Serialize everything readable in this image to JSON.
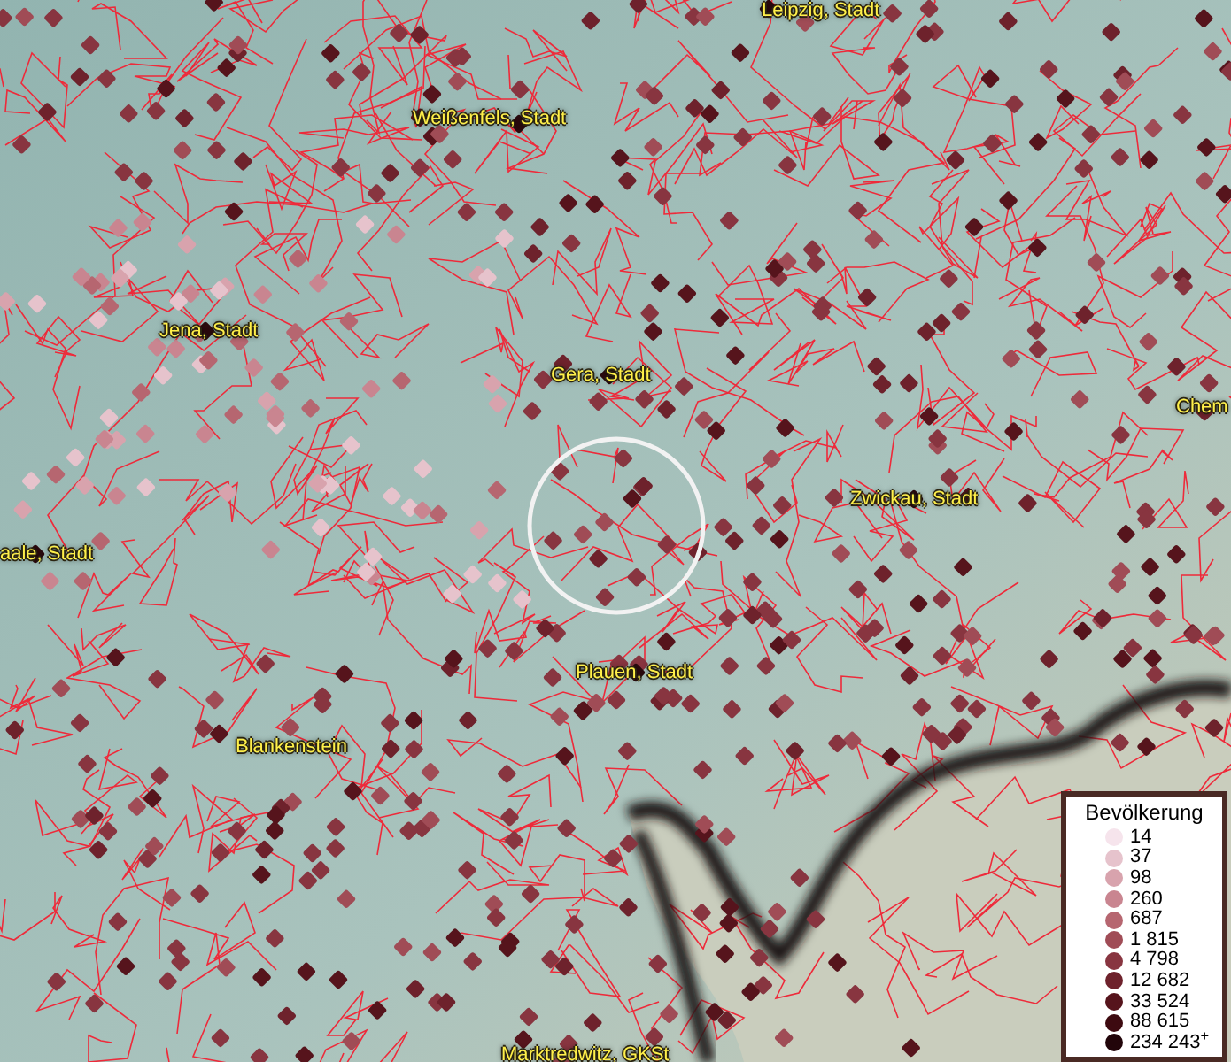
{
  "map": {
    "places": [
      {
        "name": "Leipzig, Stadt"
      },
      {
        "name": "Weißenfels, Stadt"
      },
      {
        "name": "Jena, Stadt"
      },
      {
        "name": "Gera, Stadt"
      },
      {
        "name": "Chem"
      },
      {
        "name": "Zwickau, Stadt"
      },
      {
        "name": "aale, Stadt"
      },
      {
        "name": "Plauen, Stadt"
      },
      {
        "name": "Blankenstein"
      },
      {
        "name": "Marktredwitz, GKSt"
      }
    ]
  },
  "legend": {
    "title": "Bevölkerung",
    "items": [
      {
        "label": "14",
        "color": "#f6e4ec"
      },
      {
        "label": "37",
        "color": "#e6c3cc"
      },
      {
        "label": "98",
        "color": "#d8a3ad"
      },
      {
        "label": "260",
        "color": "#c98590"
      },
      {
        "label": "687",
        "color": "#b66670"
      },
      {
        "label": "1 815",
        "color": "#a04c56"
      },
      {
        "label": "4 798",
        "color": "#883540"
      },
      {
        "label": "12 682",
        "color": "#6e222c"
      },
      {
        "label": "33 524",
        "color": "#56141c"
      },
      {
        "label": "88 615",
        "color": "#3d0a10"
      },
      {
        "label": "234 243$^{+}$",
        "color": "#22050a"
      }
    ]
  }
}
